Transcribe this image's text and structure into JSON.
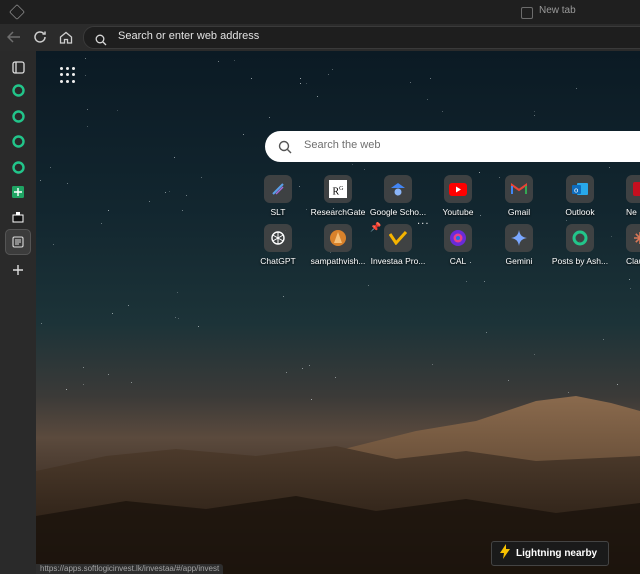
{
  "tab": {
    "title": "New tab"
  },
  "address_bar": {
    "placeholder": "Search or enter web address"
  },
  "content": {
    "search_placeholder": "Search the web",
    "quick_links": [
      {
        "label": "SLT",
        "icon": "slt-icon"
      },
      {
        "label": "ResearchGate",
        "icon": "researchgate-icon"
      },
      {
        "label": "Google Scho...",
        "icon": "google-scholar-icon"
      },
      {
        "label": "Youtube",
        "icon": "youtube-icon"
      },
      {
        "label": "Gmail",
        "icon": "gmail-icon"
      },
      {
        "label": "Outlook",
        "icon": "outlook-icon"
      },
      {
        "label": "Ne",
        "icon": "news-icon"
      },
      {
        "label": "ChatGPT",
        "icon": "chatgpt-icon"
      },
      {
        "label": "sampathvish...",
        "icon": "sampath-icon"
      },
      {
        "label": "Investaa Pro...",
        "icon": "investaa-icon"
      },
      {
        "label": "CAL",
        "icon": "cal-icon"
      },
      {
        "label": "Gemini",
        "icon": "gemini-icon"
      },
      {
        "label": "Posts by Ash...",
        "icon": "copilot-icon"
      },
      {
        "label": "Claud",
        "icon": "claude-icon"
      }
    ],
    "lightning_label": "Lightning nearby"
  },
  "status_url": "https://apps.softlogicinvest.lk/investaa/#/app/invest",
  "colors": {
    "accent": "#22c58a",
    "page_bg": "#1b1b1b",
    "toolbar": "#2b2b2b"
  }
}
